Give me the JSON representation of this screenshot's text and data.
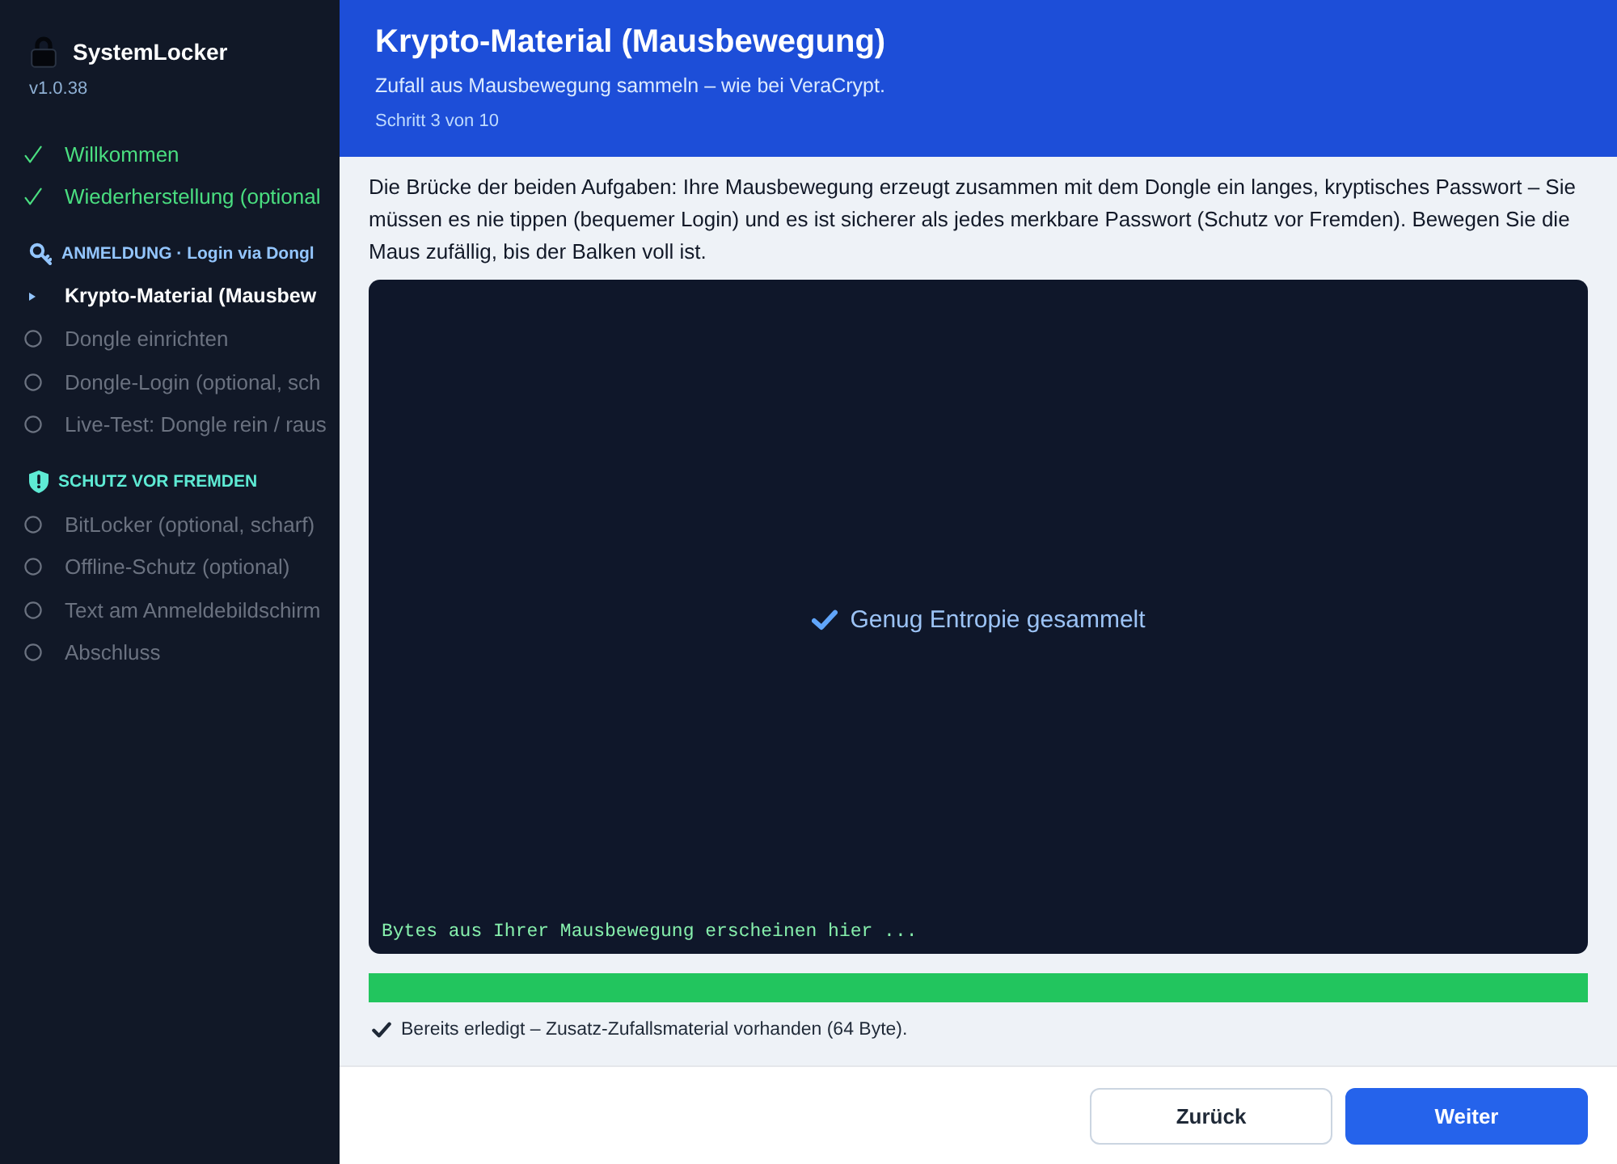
{
  "sidebar": {
    "app_name": "SystemLocker",
    "version": "v1.0.38",
    "steps": [
      {
        "label": "Willkommen",
        "done": true,
        "selected": false
      },
      {
        "label": "Wiederherstellung (optional",
        "done": true,
        "selected": false
      }
    ],
    "groups": [
      {
        "title": "ANMELDUNG · Login via Dongl",
        "color": "#93c5fd",
        "steps": [
          {
            "label": "Krypto-Material (Mausbew",
            "done": false,
            "selected": true
          },
          {
            "label": "Dongle einrichten",
            "done": false,
            "selected": false
          },
          {
            "label": "Dongle-Login (optional, sch",
            "done": false,
            "selected": false
          },
          {
            "label": "Live-Test: Dongle rein / raus",
            "done": false,
            "selected": false
          }
        ]
      },
      {
        "title": "SCHUTZ VOR FREMDEN",
        "color": "#5eead4",
        "steps": [
          {
            "label": "BitLocker (optional, scharf)",
            "done": false,
            "selected": false
          },
          {
            "label": "Offline-Schutz (optional)",
            "done": false,
            "selected": false
          },
          {
            "label": "Text am Anmeldebildschirm",
            "done": false,
            "selected": false
          },
          {
            "label": "Abschluss",
            "done": false,
            "selected": false
          }
        ]
      }
    ]
  },
  "header": {
    "title": "Krypto-Material (Mausbewegung)",
    "subtitle": "Zufall aus Mausbewegung sammeln – wie bei VeraCrypt.",
    "step": "Schritt 3 von 10"
  },
  "content": {
    "intro": "Die Brücke der beiden Aufgaben: Ihre Mausbewegung erzeugt zusammen mit dem Dongle ein langes, kryptisches Passwort – Sie müssen es nie tippen (bequemer Login) und es ist sicherer als jedes merkbare Passwort (Schutz vor Fremden). Bewegen Sie die Maus zufällig, bis der Balken voll ist.",
    "entropy_panel": {
      "status": "Genug Entropie gesammelt",
      "byte_output": "Bytes aus Ihrer Mausbewegung erscheinen hier ..."
    },
    "progress": {
      "level": 1
    },
    "note": "Bereits erledigt – Zusatz-Zufallsmaterial vorhanden (64 Byte)."
  },
  "buttons": [
    {
      "label": "Zurück",
      "kind": "back"
    },
    {
      "label": "Weiter",
      "kind": "next"
    }
  ]
}
